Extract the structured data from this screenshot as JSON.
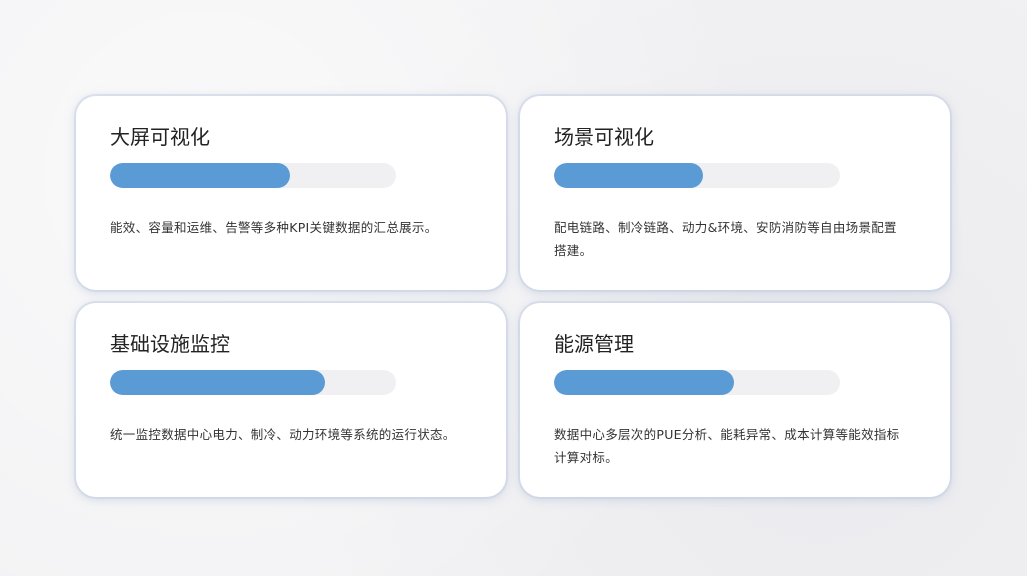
{
  "accent_color": "#5b9bd5",
  "track_color": "#f0f0f2",
  "cards": [
    {
      "title": "大屏可视化",
      "progress": 0.63,
      "description": "能效、容量和运维、告警等多种KPI关键数据的汇总展示。"
    },
    {
      "title": "场景可视化",
      "progress": 0.52,
      "description": "配电链路、制冷链路、动力&环境、安防消防等自由场景配置搭建。"
    },
    {
      "title": "基础设施监控",
      "progress": 0.75,
      "description": "统一监控数据中心电力、制冷、动力环境等系统的运行状态。"
    },
    {
      "title": "能源管理",
      "progress": 0.63,
      "description": "数据中心多层次的PUE分析、能耗异常、成本计算等能效指标计算对标。"
    }
  ]
}
